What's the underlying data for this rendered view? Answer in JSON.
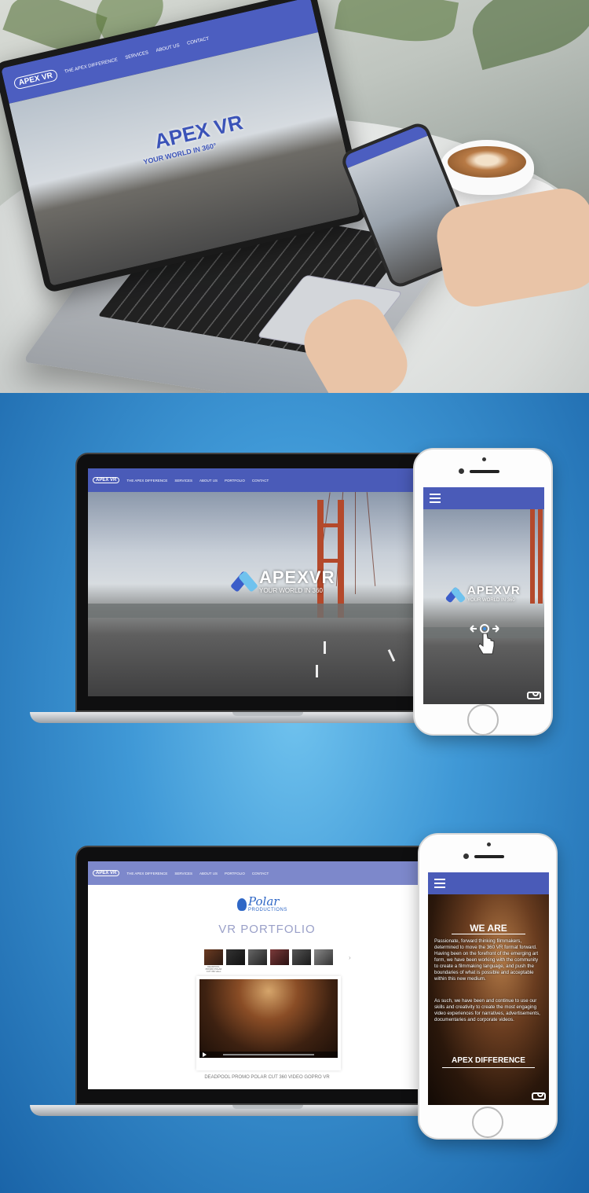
{
  "scene": {
    "laptop_site": {
      "logo": "APEX VR",
      "nav": [
        "THE APEX DIFFERENCE",
        "SERVICES",
        "ABOUT US",
        "CONTACT"
      ],
      "brand": "APEX VR",
      "tagline": "YOUR WORLD IN 360°"
    }
  },
  "showcase1": {
    "desktop": {
      "logo": "APEX VR",
      "nav": [
        "THE APEX DIFFERENCE",
        "SERVICES",
        "ABOUT US",
        "PORTFOLIO",
        "CONTACT"
      ],
      "brand": "APEXVR",
      "tagline": "YOUR WORLD IN 360"
    },
    "mobile": {
      "brand": "APEXVR",
      "tagline": "YOUR WORLD IN 360"
    }
  },
  "showcase2": {
    "desktop": {
      "logo": "APEX VR",
      "nav": [
        "THE APEX DIFFERENCE",
        "SERVICES",
        "ABOUT US",
        "PORTFOLIO",
        "CONTACT"
      ],
      "polar_word": "Polar",
      "polar_sub": "PRODUCTIONS",
      "section_title": "VR PORTFOLIO",
      "thumb_captions": [
        "DEADPOOL PROMO POLAR CUT 360 video",
        "",
        "",
        "",
        "",
        ""
      ],
      "video_title": "DEADPOOL PROMO POLAR CUT 360 VIDEO GOPRO VR"
    },
    "mobile": {
      "heading": "WE ARE",
      "para1": "Passionate, forward thinking filmmakers, determined to move the 360 VR format forward. Having been on the forefront of the emerging art form, we have been working with the community to create a filmmaking language, and push the boundaries of what is possible and acceptable within this new medium.",
      "para2": "As such, we have been and continue to use our skills and creativity to create the most engaging video experiences for narratives, advertisements, documentaries and corporate videos.",
      "heading2": "APEX DIFFERENCE"
    }
  },
  "colors": {
    "nav_blue": "#4a5bb8",
    "light_nav": "#7d88cb",
    "background_blue": "#3f98d6",
    "polar_blue": "#2f67c6"
  },
  "icons": [
    "hamburger-icon",
    "vr-headset-icon",
    "swipe-hand-icon",
    "play-icon",
    "paw-icon"
  ]
}
